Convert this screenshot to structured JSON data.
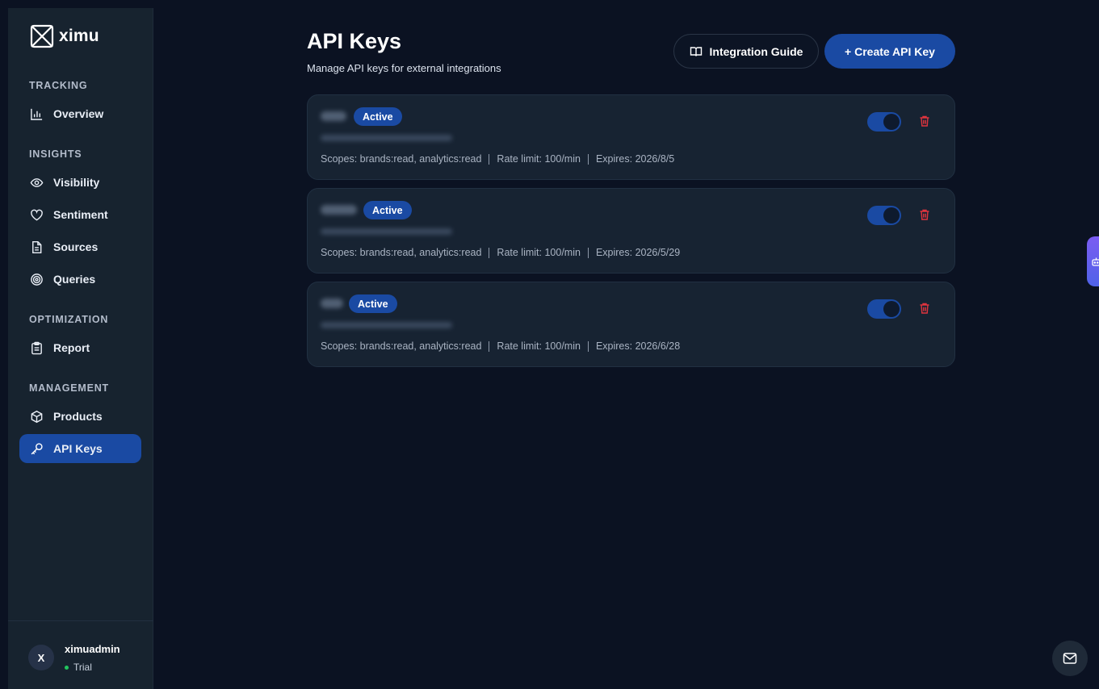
{
  "app": {
    "logo_text": "ximu"
  },
  "sidebar": {
    "sections": [
      {
        "title": "TRACKING"
      },
      {
        "title": "INSIGHTS"
      },
      {
        "title": "OPTIMIZATION"
      },
      {
        "title": "MANAGEMENT"
      }
    ],
    "items": [
      {
        "label": "Overview",
        "icon": "bar-chart-icon"
      },
      {
        "label": "Visibility",
        "icon": "eye-icon"
      },
      {
        "label": "Sentiment",
        "icon": "heart-icon"
      },
      {
        "label": "Sources",
        "icon": "document-icon"
      },
      {
        "label": "Queries",
        "icon": "target-icon"
      },
      {
        "label": "Report",
        "icon": "clipboard-icon"
      },
      {
        "label": "Products",
        "icon": "package-icon"
      },
      {
        "label": "API Keys",
        "icon": "key-icon",
        "active": true
      }
    ]
  },
  "user": {
    "initial": "X",
    "name": "ximuadmin",
    "plan": "Trial"
  },
  "header": {
    "title": "API Keys",
    "subtitle": "Manage API keys for external integrations",
    "guide_label": "Integration Guide",
    "create_label": "+ Create API Key"
  },
  "keys": [
    {
      "status": "Active",
      "scopes": "Scopes: brands:read, analytics:read",
      "rate_limit": "Rate limit: 100/min",
      "expires": "Expires: 2026/8/5",
      "enabled": true
    },
    {
      "status": "Active",
      "scopes": "Scopes: brands:read, analytics:read",
      "rate_limit": "Rate limit: 100/min",
      "expires": "Expires: 2026/5/29",
      "enabled": true
    },
    {
      "status": "Active",
      "scopes": "Scopes: brands:read, analytics:read",
      "rate_limit": "Rate limit: 100/min",
      "expires": "Expires: 2026/6/28",
      "enabled": true
    }
  ],
  "colors": {
    "background": "#0b1222",
    "sidebar": "#17232f",
    "accent": "#1a4aa3",
    "danger": "#e0343e",
    "online": "#22c55e"
  }
}
